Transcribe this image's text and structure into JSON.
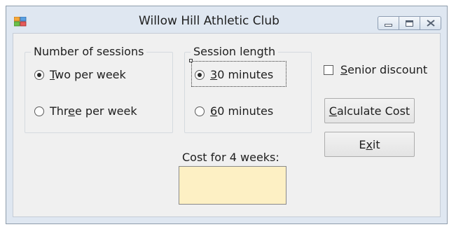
{
  "window": {
    "title": "Willow Hill Athletic Club"
  },
  "sessions_group": {
    "legend": "Number of sessions",
    "options": [
      {
        "pre": "",
        "mnemonic": "T",
        "post": "wo per week",
        "checked": true
      },
      {
        "pre": "Thr",
        "mnemonic": "e",
        "post": "e per week",
        "checked": false
      }
    ]
  },
  "length_group": {
    "legend": "Session length",
    "options": [
      {
        "pre": "",
        "mnemonic": "3",
        "post": "0 minutes",
        "checked": true
      },
      {
        "pre": "",
        "mnemonic": "6",
        "post": "0 minutes",
        "checked": false
      }
    ]
  },
  "senior_discount": {
    "pre": "",
    "mnemonic": "S",
    "post": "enior discount",
    "checked": false
  },
  "calculate_button": {
    "pre": "",
    "mnemonic": "C",
    "post": "alculate Cost"
  },
  "exit_button": {
    "pre": "E",
    "mnemonic": "x",
    "post": "it"
  },
  "cost_label": "Cost for 4 weeks:",
  "cost_value": "",
  "colors": {
    "titlebar": "#dfe7f1",
    "client": "#f0f0f0",
    "output_background": "#fdf0c4"
  }
}
